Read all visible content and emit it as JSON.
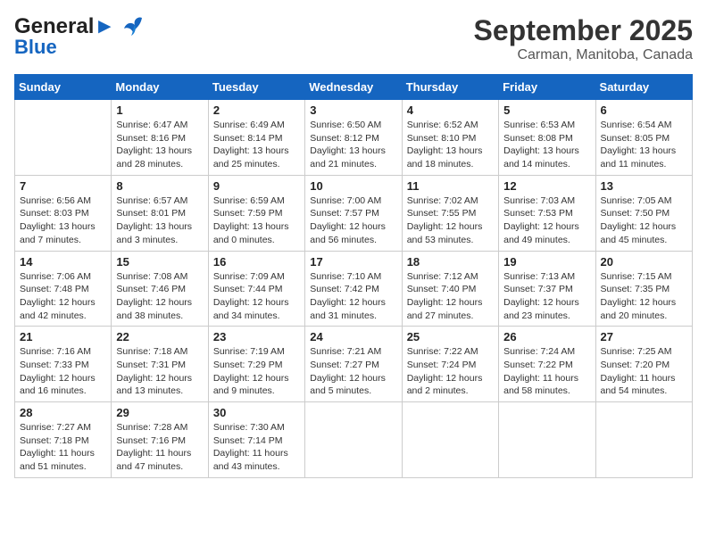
{
  "header": {
    "logo_line1": "General",
    "logo_line2": "Blue",
    "month": "September 2025",
    "location": "Carman, Manitoba, Canada"
  },
  "days_of_week": [
    "Sunday",
    "Monday",
    "Tuesday",
    "Wednesday",
    "Thursday",
    "Friday",
    "Saturday"
  ],
  "weeks": [
    [
      {
        "day": "",
        "info": ""
      },
      {
        "day": "1",
        "info": "Sunrise: 6:47 AM\nSunset: 8:16 PM\nDaylight: 13 hours\nand 28 minutes."
      },
      {
        "day": "2",
        "info": "Sunrise: 6:49 AM\nSunset: 8:14 PM\nDaylight: 13 hours\nand 25 minutes."
      },
      {
        "day": "3",
        "info": "Sunrise: 6:50 AM\nSunset: 8:12 PM\nDaylight: 13 hours\nand 21 minutes."
      },
      {
        "day": "4",
        "info": "Sunrise: 6:52 AM\nSunset: 8:10 PM\nDaylight: 13 hours\nand 18 minutes."
      },
      {
        "day": "5",
        "info": "Sunrise: 6:53 AM\nSunset: 8:08 PM\nDaylight: 13 hours\nand 14 minutes."
      },
      {
        "day": "6",
        "info": "Sunrise: 6:54 AM\nSunset: 8:05 PM\nDaylight: 13 hours\nand 11 minutes."
      }
    ],
    [
      {
        "day": "7",
        "info": "Sunrise: 6:56 AM\nSunset: 8:03 PM\nDaylight: 13 hours\nand 7 minutes."
      },
      {
        "day": "8",
        "info": "Sunrise: 6:57 AM\nSunset: 8:01 PM\nDaylight: 13 hours\nand 3 minutes."
      },
      {
        "day": "9",
        "info": "Sunrise: 6:59 AM\nSunset: 7:59 PM\nDaylight: 13 hours\nand 0 minutes."
      },
      {
        "day": "10",
        "info": "Sunrise: 7:00 AM\nSunset: 7:57 PM\nDaylight: 12 hours\nand 56 minutes."
      },
      {
        "day": "11",
        "info": "Sunrise: 7:02 AM\nSunset: 7:55 PM\nDaylight: 12 hours\nand 53 minutes."
      },
      {
        "day": "12",
        "info": "Sunrise: 7:03 AM\nSunset: 7:53 PM\nDaylight: 12 hours\nand 49 minutes."
      },
      {
        "day": "13",
        "info": "Sunrise: 7:05 AM\nSunset: 7:50 PM\nDaylight: 12 hours\nand 45 minutes."
      }
    ],
    [
      {
        "day": "14",
        "info": "Sunrise: 7:06 AM\nSunset: 7:48 PM\nDaylight: 12 hours\nand 42 minutes."
      },
      {
        "day": "15",
        "info": "Sunrise: 7:08 AM\nSunset: 7:46 PM\nDaylight: 12 hours\nand 38 minutes."
      },
      {
        "day": "16",
        "info": "Sunrise: 7:09 AM\nSunset: 7:44 PM\nDaylight: 12 hours\nand 34 minutes."
      },
      {
        "day": "17",
        "info": "Sunrise: 7:10 AM\nSunset: 7:42 PM\nDaylight: 12 hours\nand 31 minutes."
      },
      {
        "day": "18",
        "info": "Sunrise: 7:12 AM\nSunset: 7:40 PM\nDaylight: 12 hours\nand 27 minutes."
      },
      {
        "day": "19",
        "info": "Sunrise: 7:13 AM\nSunset: 7:37 PM\nDaylight: 12 hours\nand 23 minutes."
      },
      {
        "day": "20",
        "info": "Sunrise: 7:15 AM\nSunset: 7:35 PM\nDaylight: 12 hours\nand 20 minutes."
      }
    ],
    [
      {
        "day": "21",
        "info": "Sunrise: 7:16 AM\nSunset: 7:33 PM\nDaylight: 12 hours\nand 16 minutes."
      },
      {
        "day": "22",
        "info": "Sunrise: 7:18 AM\nSunset: 7:31 PM\nDaylight: 12 hours\nand 13 minutes."
      },
      {
        "day": "23",
        "info": "Sunrise: 7:19 AM\nSunset: 7:29 PM\nDaylight: 12 hours\nand 9 minutes."
      },
      {
        "day": "24",
        "info": "Sunrise: 7:21 AM\nSunset: 7:27 PM\nDaylight: 12 hours\nand 5 minutes."
      },
      {
        "day": "25",
        "info": "Sunrise: 7:22 AM\nSunset: 7:24 PM\nDaylight: 12 hours\nand 2 minutes."
      },
      {
        "day": "26",
        "info": "Sunrise: 7:24 AM\nSunset: 7:22 PM\nDaylight: 11 hours\nand 58 minutes."
      },
      {
        "day": "27",
        "info": "Sunrise: 7:25 AM\nSunset: 7:20 PM\nDaylight: 11 hours\nand 54 minutes."
      }
    ],
    [
      {
        "day": "28",
        "info": "Sunrise: 7:27 AM\nSunset: 7:18 PM\nDaylight: 11 hours\nand 51 minutes."
      },
      {
        "day": "29",
        "info": "Sunrise: 7:28 AM\nSunset: 7:16 PM\nDaylight: 11 hours\nand 47 minutes."
      },
      {
        "day": "30",
        "info": "Sunrise: 7:30 AM\nSunset: 7:14 PM\nDaylight: 11 hours\nand 43 minutes."
      },
      {
        "day": "",
        "info": ""
      },
      {
        "day": "",
        "info": ""
      },
      {
        "day": "",
        "info": ""
      },
      {
        "day": "",
        "info": ""
      }
    ]
  ]
}
